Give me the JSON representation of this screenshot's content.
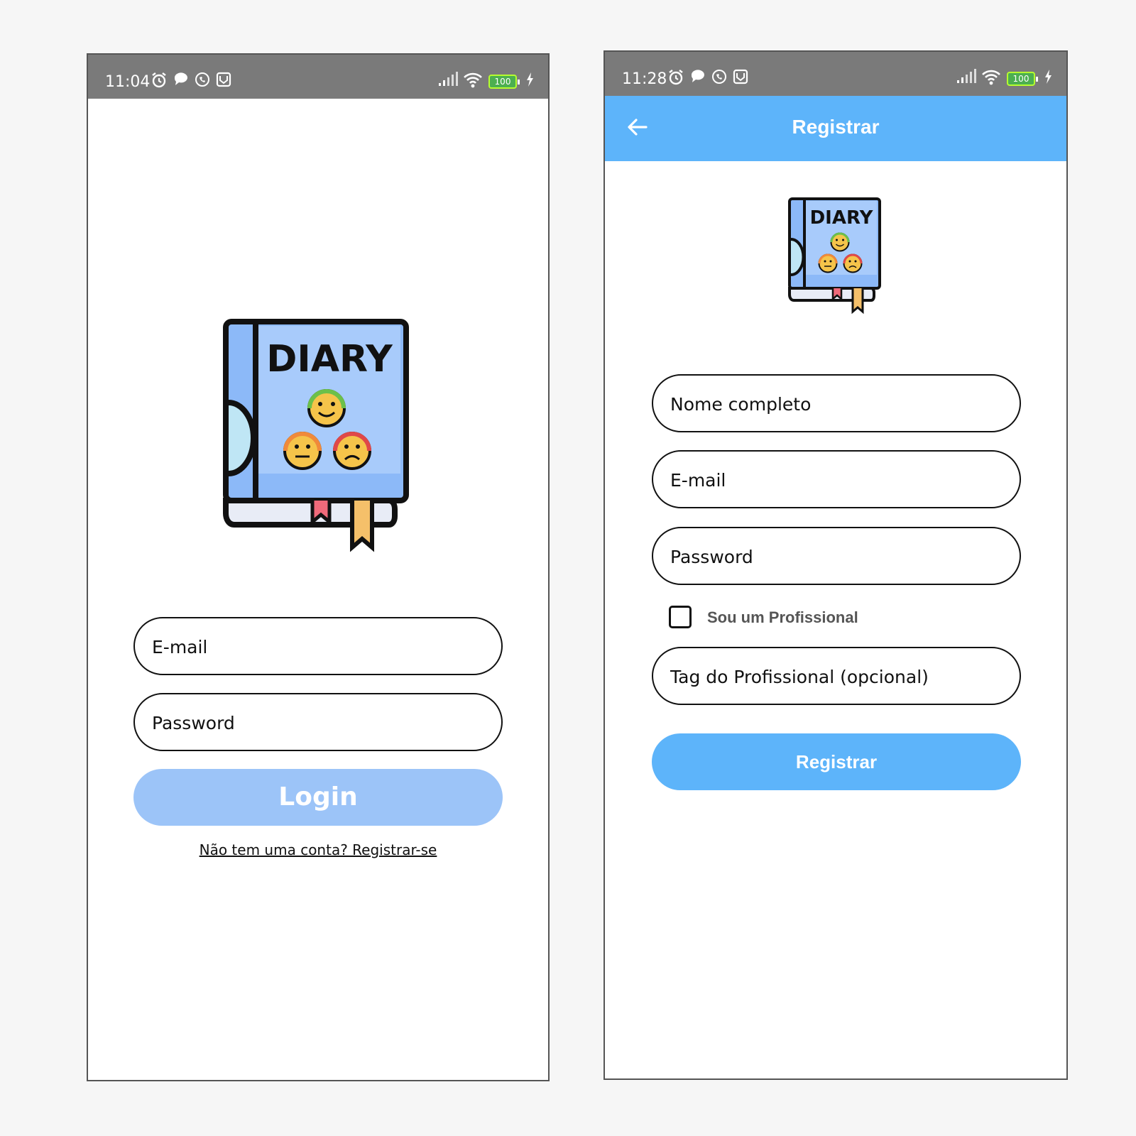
{
  "login_screen": {
    "status_bar": {
      "time": "11:04",
      "battery": "100"
    },
    "logo": {
      "text": "DIARY"
    },
    "email_field": {
      "placeholder": "E-mail"
    },
    "password_field": {
      "placeholder": "Password"
    },
    "login_button": {
      "label": "Login"
    },
    "register_link": {
      "label": "Não tem uma conta? Registrar-se"
    }
  },
  "register_screen": {
    "status_bar": {
      "time": "11:28",
      "battery": "100"
    },
    "app_bar": {
      "title": "Registrar"
    },
    "logo": {
      "text": "DIARY"
    },
    "name_field": {
      "placeholder": "Nome completo"
    },
    "email_field": {
      "placeholder": "E-mail"
    },
    "password_field": {
      "placeholder": "Password"
    },
    "professional_checkbox": {
      "label": "Sou um Profissional",
      "checked": false
    },
    "tag_field": {
      "placeholder": "Tag do Profissional (opcional)"
    },
    "register_button": {
      "label": "Registrar"
    }
  },
  "colors": {
    "accent": "#5db4fa",
    "login_button": "#9cc4f8",
    "status_bar": "#7a7a7a"
  }
}
